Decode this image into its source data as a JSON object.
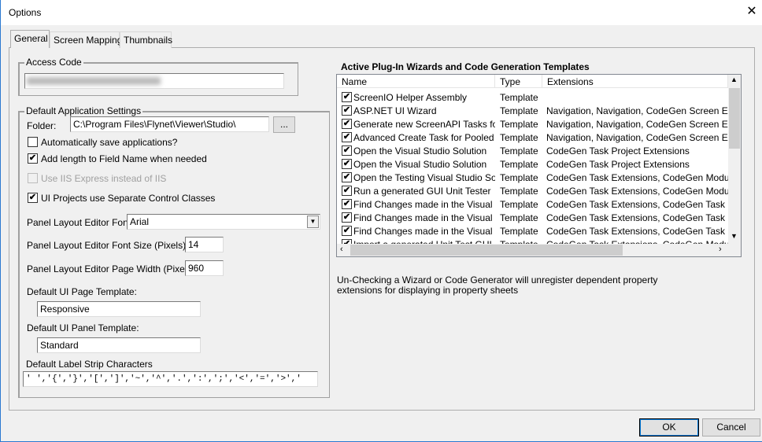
{
  "window": {
    "title": "Options",
    "close_icon": "close-icon"
  },
  "tabs": [
    {
      "label": "General",
      "active": true
    },
    {
      "label": "Screen Mapping",
      "active": false
    },
    {
      "label": "Thumbnails",
      "active": false
    }
  ],
  "access_code": {
    "label": "Access Code"
  },
  "app_settings": {
    "label": "Default Application Settings",
    "folder_label": "Folder:",
    "folder_value": "C:\\Program Files\\Flynet\\Viewer\\Studio\\",
    "browse_label": "...",
    "checkboxes": [
      {
        "label": "Automatically save applications?",
        "checked": false,
        "enabled": true
      },
      {
        "label": "Add length to Field Name when needed",
        "checked": true,
        "enabled": true
      },
      {
        "label": "Use IIS Express instead of IIS",
        "checked": false,
        "enabled": false
      },
      {
        "label": "UI Projects use Separate Control Classes",
        "checked": true,
        "enabled": true
      }
    ],
    "font_label": "Panel Layout Editor Font:",
    "font_value": "Arial",
    "font_size_label": "Panel Layout Editor Font Size (Pixels):",
    "font_size_value": "14",
    "page_width_label": "Panel Layout Editor Page Width (Pixels):",
    "page_width_value": "960",
    "page_template_label": "Default UI Page Template:",
    "page_template_value": "Responsive",
    "panel_template_label": "Default UI Panel Template:",
    "panel_template_value": "Standard",
    "strip_label": "Default Label Strip Characters",
    "strip_value": "' ','{','}','[',']','~','^','.',':',';','<','=','>','"
  },
  "plugins": {
    "heading": "Active Plug-In Wizards and Code Generation Templates",
    "columns": [
      "Name",
      "Type",
      "Extensions"
    ],
    "rows": [
      {
        "name": "ScreenIO Helper Assembly",
        "type": "Template",
        "ext": "",
        "checked": true
      },
      {
        "name": "ASP.NET UI Wizard",
        "type": "Template",
        "ext": "Navigation, Navigation, CodeGen Screen Extens",
        "checked": true
      },
      {
        "name": "Generate new ScreenAPI Tasks for...",
        "type": "Template",
        "ext": "Navigation, Navigation, CodeGen Screen Extens",
        "checked": true
      },
      {
        "name": "Advanced Create Task for Pooled ...",
        "type": "Template",
        "ext": "Navigation, Navigation, CodeGen Screen Extens",
        "checked": true
      },
      {
        "name": "Open the Visual Studio Solution",
        "type": "Template",
        "ext": "CodeGen Task Project Extensions",
        "checked": true
      },
      {
        "name": "Open the Visual Studio Solution",
        "type": "Template",
        "ext": "CodeGen Task Project Extensions",
        "checked": true
      },
      {
        "name": "Open the Testing Visual Studio Sol...",
        "type": "Template",
        "ext": "CodeGen Task Extensions, CodeGen Module Ex",
        "checked": true
      },
      {
        "name": "Run a generated GUI Unit Tester",
        "type": "Template",
        "ext": "CodeGen Task Extensions, CodeGen Module Ex",
        "checked": true
      },
      {
        "name": "Find Changes made in the Visual St...",
        "type": "Template",
        "ext": "CodeGen Task Extensions, CodeGen Task Proje",
        "checked": true
      },
      {
        "name": "Find Changes made in the Visual St...",
        "type": "Template",
        "ext": "CodeGen Task Extensions, CodeGen Task Proje",
        "checked": true
      },
      {
        "name": "Find Changes made in the Visual St...",
        "type": "Template",
        "ext": "CodeGen Task Extensions, CodeGen Task Proje",
        "checked": true
      },
      {
        "name": "Import a generated Unit Test GUI F...",
        "type": "Template",
        "ext": "CodeGen Task Extensions, CodeGen Module Ex",
        "checked": true
      }
    ],
    "note_line1": "Un-Checking a Wizard or Code Generator will unregister dependent property",
    "note_line2": "extensions for displaying in property sheets"
  },
  "footer": {
    "ok_label": "OK",
    "cancel_label": "Cancel"
  }
}
